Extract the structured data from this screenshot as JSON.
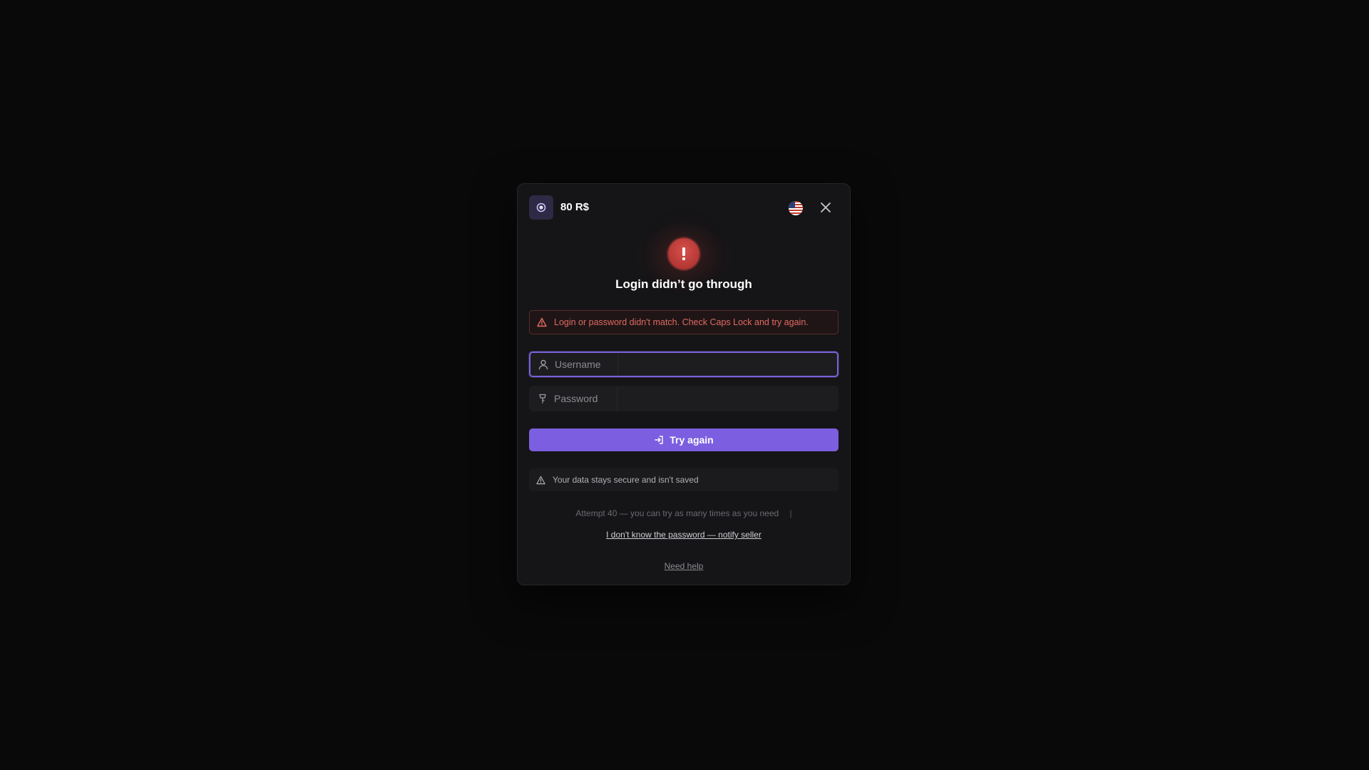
{
  "header": {
    "brand_icon": "coin-icon",
    "balance": "80 R$",
    "language_icon": "us-flag-icon",
    "close_icon": "close-icon"
  },
  "status": {
    "icon": "exclamation-icon",
    "title": "Login didn’t go through"
  },
  "error": {
    "icon": "warning-triangle-icon",
    "message": "Login or password didn't match. Check Caps Lock and try again."
  },
  "form": {
    "username": {
      "icon": "user-icon",
      "label": "Username",
      "value": ""
    },
    "password": {
      "icon": "key-icon",
      "label": "Password",
      "value": ""
    },
    "submit_label": "Try again",
    "submit_icon": "login-arrow-icon"
  },
  "security": {
    "icon": "warning-triangle-icon",
    "text": "Your data stays secure and isn't saved"
  },
  "footer": {
    "attempt_text": "Attempt 40 — you can try as many times as you need",
    "separator": "|",
    "notify_link": "I don't know the password — notify seller",
    "help_link": "Need help"
  },
  "colors": {
    "accent": "#7b5fe0",
    "error": "#e06a62",
    "background": "#09090a",
    "panel": "#151517"
  }
}
